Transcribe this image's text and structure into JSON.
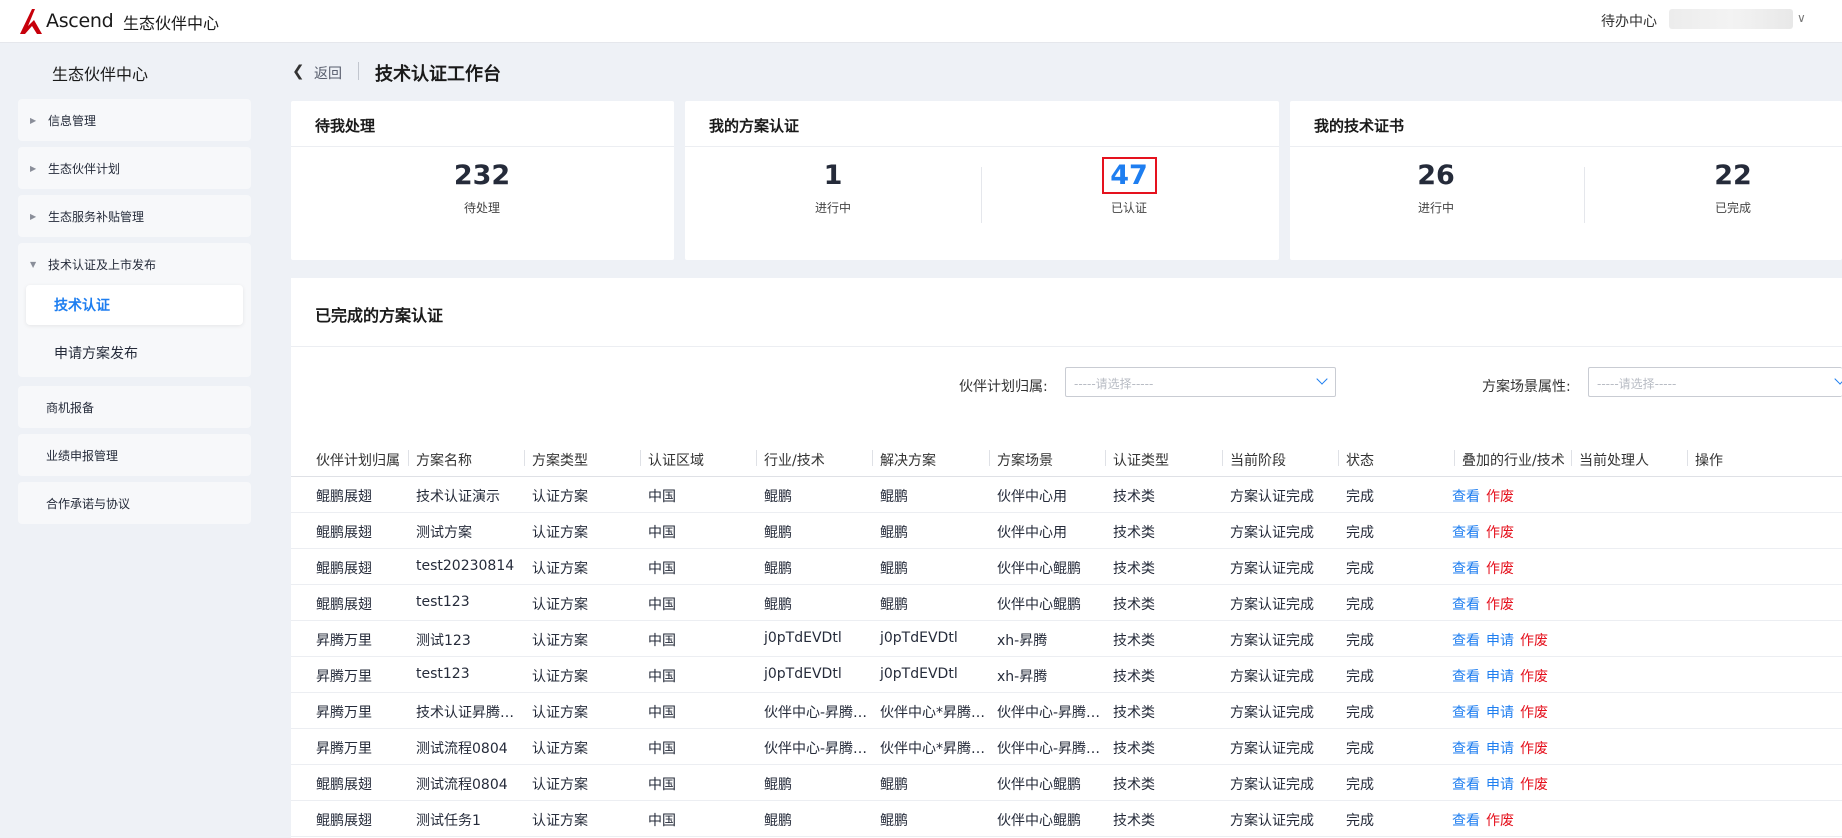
{
  "header": {
    "logo_text": "Ascend",
    "site_name": "生态伙伴中心",
    "todo_center": "待办中心"
  },
  "sidebar": {
    "title": "生态伙伴中心",
    "groups": [
      {
        "label": "信息管理"
      },
      {
        "label": "生态伙伴计划"
      },
      {
        "label": "生态服务补贴管理"
      },
      {
        "label": "技术认证及上市发布",
        "children": [
          {
            "label": "技术认证"
          },
          {
            "label": "申请方案发布"
          }
        ]
      },
      {
        "label": "商机报备"
      },
      {
        "label": "业绩申报管理"
      },
      {
        "label": "合作承诺与协议"
      }
    ]
  },
  "page": {
    "back_label": "返回",
    "title": "技术认证工作台"
  },
  "cards": {
    "pending": {
      "title": "待我处理",
      "stats": [
        {
          "value": "232",
          "label": "待处理"
        }
      ]
    },
    "solution": {
      "title": "我的方案认证",
      "stats": [
        {
          "value": "1",
          "label": "进行中"
        },
        {
          "value": "47",
          "label": "已认证"
        }
      ]
    },
    "certificate": {
      "title": "我的技术证书",
      "stats": [
        {
          "value": "26",
          "label": "进行中"
        },
        {
          "value": "22",
          "label": "已完成"
        }
      ]
    }
  },
  "table_panel": {
    "title": "已完成的方案认证",
    "filters": [
      {
        "label": "伙伴计划归属:",
        "placeholder": "-----请选择-----"
      },
      {
        "label": "方案场景属性:",
        "placeholder": "-----请选择-----"
      }
    ],
    "columns": [
      "伙伴计划归属",
      "方案名称",
      "方案类型",
      "认证区域",
      "行业/技术",
      "解决方案",
      "方案场景",
      "认证类型",
      "当前阶段",
      "状态",
      "叠加的行业/技术",
      "当前处理人",
      "操作"
    ],
    "rows": [
      {
        "cells": [
          "鲲鹏展翅",
          "技术认证演示",
          "认证方案",
          "中国",
          "鲲鹏",
          "鲲鹏",
          "伙伴中心用",
          "技术类",
          "方案认证完成",
          "完成",
          "",
          ""
        ],
        "actions": [
          "查看",
          "作废"
        ]
      },
      {
        "cells": [
          "鲲鹏展翅",
          "测试方案",
          "认证方案",
          "中国",
          "鲲鹏",
          "鲲鹏",
          "伙伴中心用",
          "技术类",
          "方案认证完成",
          "完成",
          "",
          ""
        ],
        "actions": [
          "查看",
          "作废"
        ]
      },
      {
        "cells": [
          "鲲鹏展翅",
          "test20230814",
          "认证方案",
          "中国",
          "鲲鹏",
          "鲲鹏",
          "伙伴中心鲲鹏",
          "技术类",
          "方案认证完成",
          "完成",
          "",
          ""
        ],
        "actions": [
          "查看",
          "作废"
        ]
      },
      {
        "cells": [
          "鲲鹏展翅",
          "test123",
          "认证方案",
          "中国",
          "鲲鹏",
          "鲲鹏",
          "伙伴中心鲲鹏",
          "技术类",
          "方案认证完成",
          "完成",
          "",
          ""
        ],
        "actions": [
          "查看",
          "作废"
        ]
      },
      {
        "cells": [
          "昇腾万里",
          "测试123",
          "认证方案",
          "中国",
          "j0pTdEVDtl",
          "j0pTdEVDtl",
          "xh-昇腾",
          "技术类",
          "方案认证完成",
          "完成",
          "",
          ""
        ],
        "actions": [
          "查看",
          "申请",
          "作废"
        ]
      },
      {
        "cells": [
          "昇腾万里",
          "test123",
          "认证方案",
          "中国",
          "j0pTdEVDtl",
          "j0pTdEVDtl",
          "xh-昇腾",
          "技术类",
          "方案认证完成",
          "完成",
          "",
          ""
        ],
        "actions": [
          "查看",
          "申请",
          "作废"
        ]
      },
      {
        "cells": [
          "昇腾万里",
          "技术认证昇腾0…",
          "认证方案",
          "中国",
          "伙伴中心-昇腾…",
          "伙伴中心*昇腾…",
          "伙伴中心-昇腾…",
          "技术类",
          "方案认证完成",
          "完成",
          "",
          ""
        ],
        "actions": [
          "查看",
          "申请",
          "作废"
        ]
      },
      {
        "cells": [
          "昇腾万里",
          "测试流程0804",
          "认证方案",
          "中国",
          "伙伴中心-昇腾…",
          "伙伴中心*昇腾…",
          "伙伴中心-昇腾…",
          "技术类",
          "方案认证完成",
          "完成",
          "",
          ""
        ],
        "actions": [
          "查看",
          "申请",
          "作废"
        ]
      },
      {
        "cells": [
          "鲲鹏展翅",
          "测试流程0804",
          "认证方案",
          "中国",
          "鲲鹏",
          "鲲鹏",
          "伙伴中心鲲鹏",
          "技术类",
          "方案认证完成",
          "完成",
          "",
          ""
        ],
        "actions": [
          "查看",
          "申请",
          "作废"
        ]
      },
      {
        "cells": [
          "鲲鹏展翅",
          "测试任务1",
          "认证方案",
          "中国",
          "鲲鹏",
          "鲲鹏",
          "伙伴中心鲲鹏",
          "技术类",
          "方案认证完成",
          "完成",
          "",
          ""
        ],
        "actions": [
          "查看",
          "作废"
        ]
      }
    ]
  }
}
